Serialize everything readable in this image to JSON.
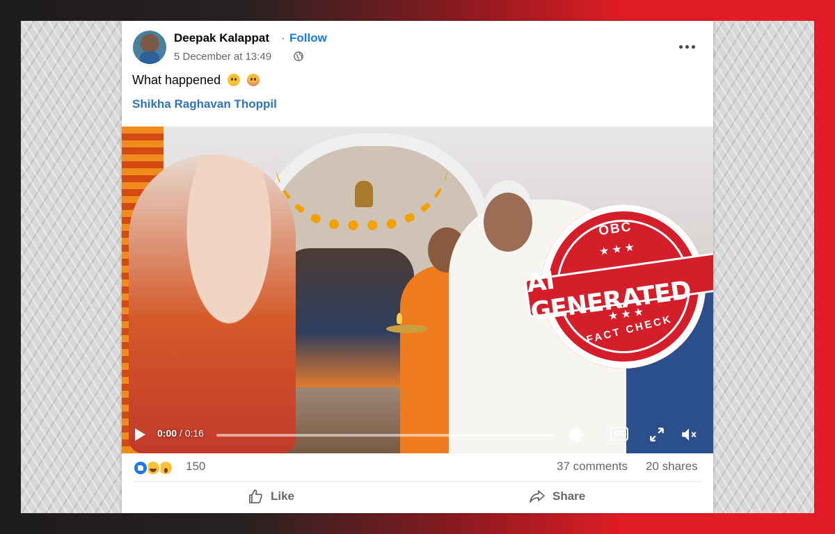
{
  "post": {
    "author": "Deepak Kalappat",
    "separator": "·",
    "follow_label": "Follow",
    "timestamp": "5 December at 13:49",
    "audience_icon": "globe-icon",
    "caption": "What happened",
    "caption_emojis": [
      "confused-face-emoji",
      "flushed-face-emoji"
    ],
    "mention": "Shikha Raghavan Thoppil"
  },
  "video": {
    "current_time": "0:00",
    "time_separator": " / ",
    "duration": "0:16",
    "progress": 0,
    "controls": [
      "play-icon",
      "settings-gear-icon",
      "closed-captions-icon",
      "fullscreen-icon",
      "muted-volume-icon"
    ],
    "cc_label": "CC"
  },
  "stamp": {
    "logo": "OBC",
    "stars": "★★★",
    "headline": "AI GENERATED",
    "subtitle": "FACT CHECK",
    "color": "#d41f2a"
  },
  "engagement": {
    "reaction_icons": [
      "like-reaction-icon",
      "haha-reaction-icon",
      "wow-reaction-icon"
    ],
    "reaction_count": "150",
    "comments": "37 comments",
    "shares": "20 shares"
  },
  "actions": {
    "like_label": "Like",
    "share_label": "Share"
  },
  "colors": {
    "link_blue": "#1877f2",
    "mention_blue": "#2d73c0",
    "secondary_text": "#65676b"
  }
}
